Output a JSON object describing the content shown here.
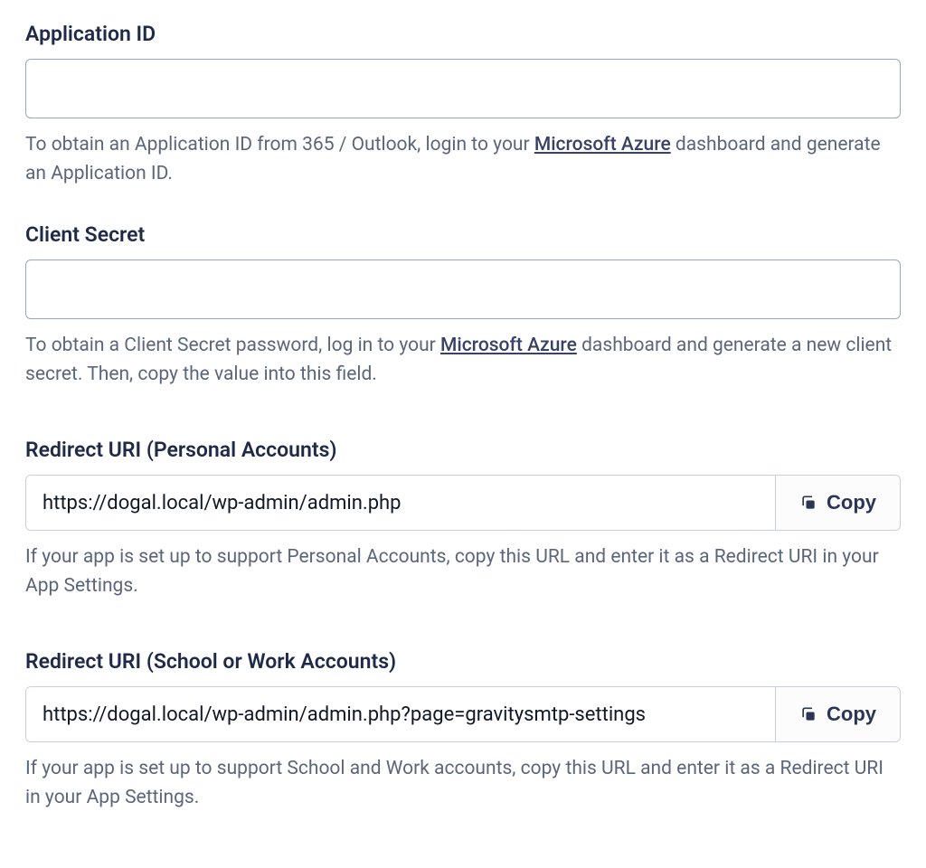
{
  "fields": {
    "application_id": {
      "label": "Application ID",
      "value": "",
      "help_before": "To obtain an Application ID from 365 / Outlook, login to your ",
      "link_text": "Microsoft Azure",
      "help_after": " dashboard and generate an Application ID."
    },
    "client_secret": {
      "label": "Client Secret",
      "value": "",
      "help_before": "To obtain a Client Secret password, log in to your ",
      "link_text": "Microsoft Azure",
      "help_after": " dashboard and generate a new client secret. Then, copy the value into this field."
    },
    "redirect_personal": {
      "label": "Redirect URI (Personal Accounts)",
      "value": "https://dogal.local/wp-admin/admin.php",
      "copy_label": "Copy",
      "help": "If your app is set up to support Personal Accounts, copy this URL and enter it as a Redirect URI in your App Settings."
    },
    "redirect_school": {
      "label": "Redirect URI (School or Work Accounts)",
      "value": "https://dogal.local/wp-admin/admin.php?page=gravitysmtp-settings",
      "copy_label": "Copy",
      "help": "If your app is set up to support School and Work accounts, copy this URL and enter it as a Redirect URI in your App Settings."
    }
  }
}
